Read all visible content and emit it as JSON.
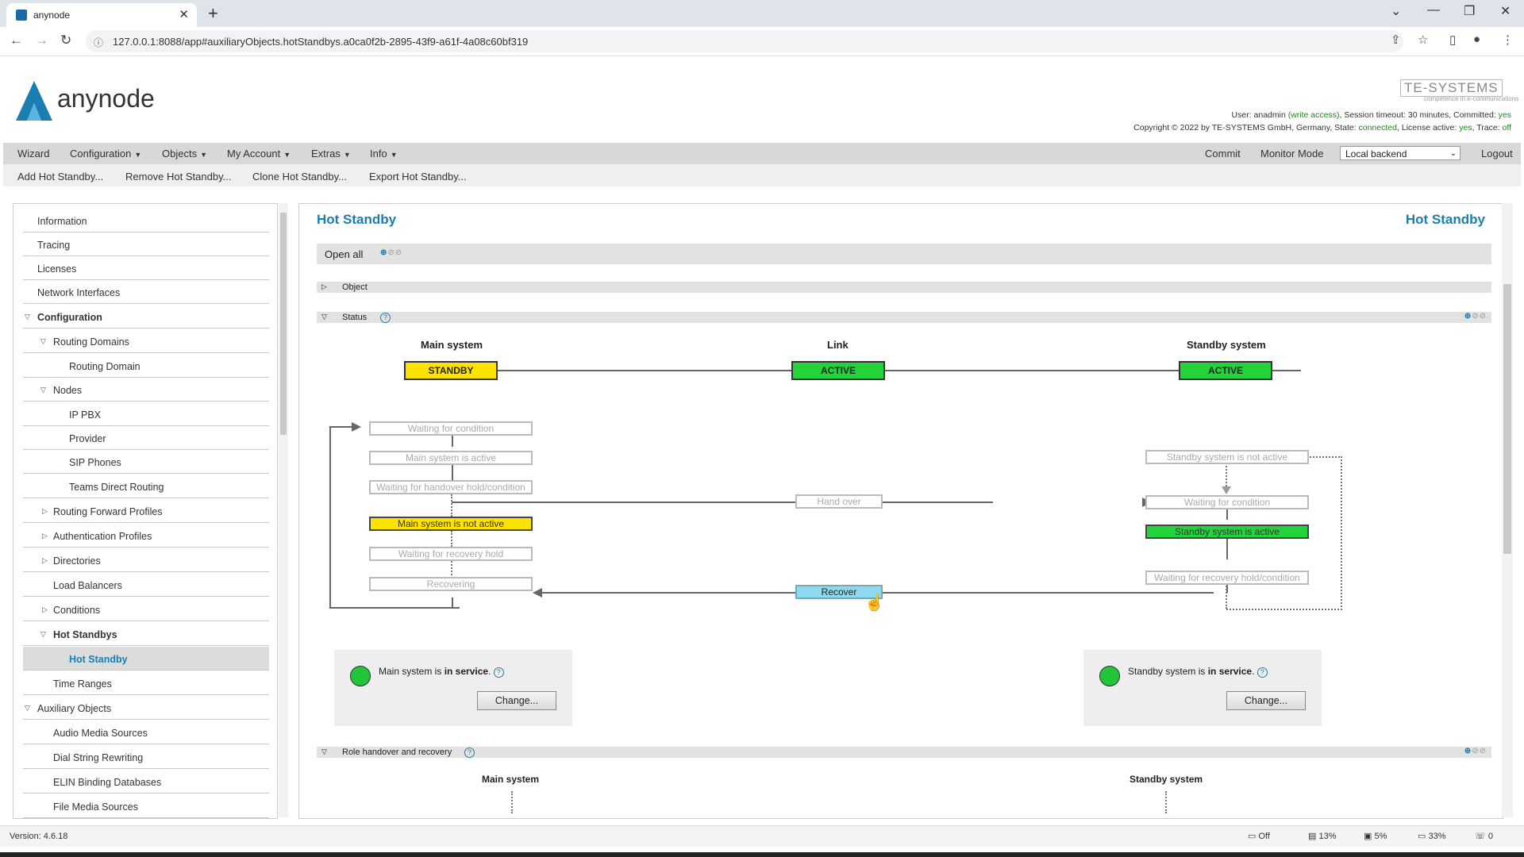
{
  "browser": {
    "tab_title": "anynode",
    "url": "127.0.0.1:8088/app#auxiliaryObjects.hotStandbys.a0ca0f2b-2895-43f9-a61f-4a08c60bf319"
  },
  "header": {
    "logo_text": "anynode",
    "brand": "TE-SYSTEMS",
    "brand_tagline": "competence in e-communications",
    "user_prefix": "User: anadmin ",
    "user_access": "(write access)",
    "user_mid": ", Session timeout: 30 minutes, Committed: ",
    "committed": "yes",
    "copy_prefix": "Copyright © 2022 by TE-SYSTEMS GmbH, Germany, State: ",
    "state": "connected",
    "copy_mid": ", License active: ",
    "license": "yes",
    "copy_trace": ", Trace: ",
    "trace": "off"
  },
  "menu": {
    "wizard": "Wizard",
    "configuration": "Configuration",
    "objects": "Objects",
    "my_account": "My Account",
    "extras": "Extras",
    "info": "Info",
    "commit": "Commit",
    "monitor_mode": "Monitor Mode",
    "backend": "Local backend",
    "logout": "Logout"
  },
  "actions": {
    "add": "Add Hot Standby...",
    "remove": "Remove Hot Standby...",
    "clone": "Clone Hot Standby...",
    "export": "Export Hot Standby..."
  },
  "sidebar": {
    "items": [
      "Information",
      "Tracing",
      "Licenses",
      "Network Interfaces",
      "Configuration",
      "Routing Domains",
      "Routing Domain",
      "Nodes",
      "IP PBX",
      "Provider",
      "SIP Phones",
      "Teams Direct Routing",
      "Routing Forward Profiles",
      "Authentication Profiles",
      "Directories",
      "Load Balancers",
      "Conditions",
      "Hot Standbys",
      "Hot Standby",
      "Time Ranges",
      "Auxiliary Objects",
      "Audio Media Sources",
      "Dial String Rewriting",
      "ELIN Binding Databases",
      "File Media Sources"
    ]
  },
  "main": {
    "title": "Hot Standby",
    "title_right": "Hot Standby",
    "open_all": "Open all",
    "sections": {
      "object": "Object",
      "status": "Status",
      "role": "Role handover and recovery"
    },
    "status": {
      "main_header": "Main system",
      "link_header": "Link",
      "standby_header": "Standby system",
      "main_state": "STANDBY",
      "link_state": "ACTIVE",
      "standby_state": "ACTIVE"
    },
    "flow": {
      "waiting_condition": "Waiting for condition",
      "main_active": "Main system is active",
      "waiting_handover": "Waiting for handover hold/condition",
      "main_not_active": "Main system is not active",
      "waiting_recovery": "Waiting for recovery hold",
      "recovering": "Recovering",
      "hand_over": "Hand over",
      "recover": "Recover",
      "standby_not_active": "Standby system is not active",
      "standby_waiting_condition": "Waiting for condition",
      "standby_active": "Standby system is active",
      "standby_waiting_recovery": "Waiting for recovery hold/condition"
    },
    "service": {
      "main_prefix": "Main system is ",
      "main_bold": "in service",
      "standby_prefix": "Standby system is ",
      "standby_bold": "in service",
      "suffix": ".",
      "change": "Change..."
    },
    "role": {
      "main_header": "Main system",
      "standby_header": "Standby system"
    }
  },
  "statusbar": {
    "version": "Version: 4.6.18",
    "rec": "Off",
    "disk": "13%",
    "cpu": "5%",
    "mem": "33%",
    "calls": "0"
  },
  "colors": {
    "accent": "#1a7fb0",
    "standby_yellow": "#ffe300",
    "active_green": "#22d43a",
    "recover_blue": "#8fd8f2"
  }
}
